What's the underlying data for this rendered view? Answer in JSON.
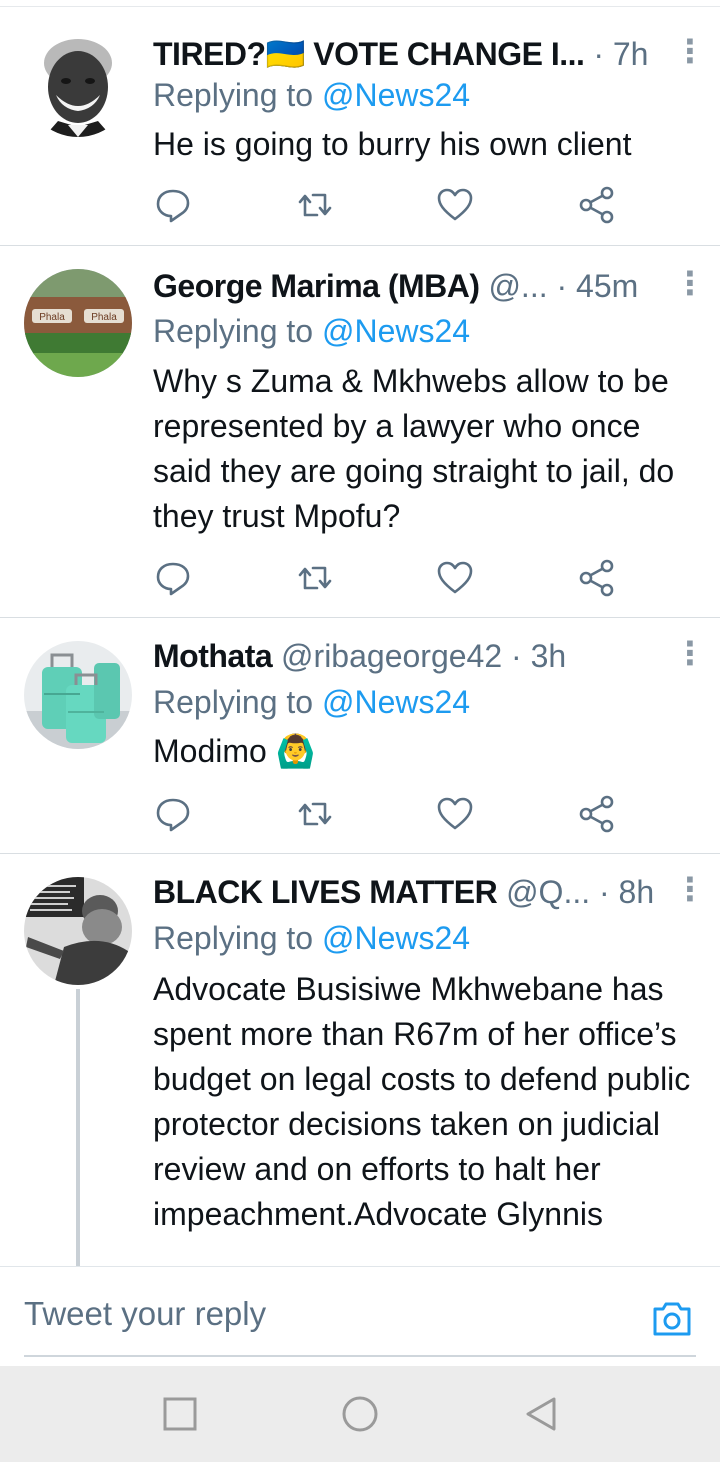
{
  "colors": {
    "accent": "#1d9bf0",
    "muted": "#5b7083",
    "text": "#0f1419"
  },
  "tweets": [
    {
      "name": "TIRED?🇺🇦 VOTE CHANGE I...",
      "handle": "",
      "sep": "·",
      "time": "7h",
      "replying_prefix": "Replying to",
      "replying_handle": "@News24",
      "text": "He is going to burry his own client",
      "avatar": "mandela-portrait"
    },
    {
      "name": "George Marima (MBA)",
      "handle": "@...",
      "sep": "·",
      "time": "45m",
      "replying_prefix": "Replying to",
      "replying_handle": "@News24",
      "text": "Why s Zuma & Mkhwebs allow to be represented by a lawyer who once said they are going straight to jail, do they trust Mpofu?",
      "avatar": "phala-phala-sign",
      "avatar_text": "Phala Phala"
    },
    {
      "name": "Mothata",
      "handle": "@ribageorge42",
      "sep": "·",
      "time": "3h",
      "replying_prefix": "Replying to",
      "replying_handle": "@News24",
      "text": "Modimo 🙆‍♂️",
      "avatar": "green-suitcases"
    },
    {
      "name": "BLACK LIVES MATTER",
      "handle": "@Q...",
      "sep": "·",
      "time": "8h",
      "replying_prefix": "Replying to",
      "replying_handle": "@News24",
      "text": "Advocate Busisiwe Mkhwebane has spent more than R67m of her office’s budget on legal costs to defend public protector decisions taken on judicial review and on efforts to halt her impeachment.Advocate Glynnis",
      "avatar": "black-white-portrait"
    }
  ],
  "composer": {
    "placeholder": "Tweet your reply",
    "camera_icon": "camera-icon"
  },
  "icons": {
    "reply": "reply-icon",
    "retweet": "retweet-icon",
    "like": "heart-icon",
    "share": "share-icon",
    "more": "more-vertical-icon",
    "nav_recent": "square-icon",
    "nav_home": "circle-icon",
    "nav_back": "triangle-back-icon"
  }
}
